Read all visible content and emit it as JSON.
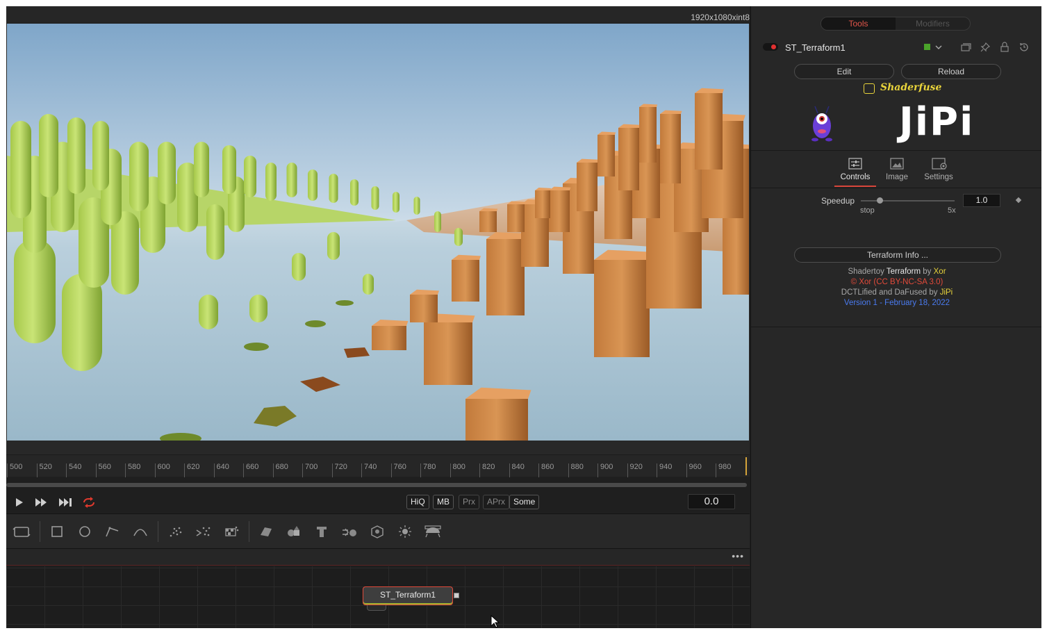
{
  "viewer": {
    "resolution": "1920x1080xint8"
  },
  "timeline": {
    "ticks": [
      "500",
      "520",
      "540",
      "560",
      "580",
      "600",
      "620",
      "640",
      "660",
      "680",
      "700",
      "720",
      "740",
      "760",
      "780",
      "800",
      "820",
      "840",
      "860",
      "880",
      "900",
      "920",
      "940",
      "960",
      "980"
    ]
  },
  "transport": {
    "modes": [
      "HiQ",
      "MB",
      "Prx",
      "APrx",
      "Some"
    ],
    "time": "0.0"
  },
  "toolbar": {
    "tools": [
      "background-icon",
      "rectangle-mask-icon",
      "ellipse-mask-icon",
      "polygon-mask-icon",
      "bspline-mask-icon",
      "particle-emitter-icon",
      "particle-render-icon",
      "particle-checker-icon",
      "image-plane-3d-icon",
      "shape-3d-icon",
      "text-3d-icon",
      "merge-3d-icon",
      "renderer-3d-icon",
      "light-3d-icon",
      "camera-3d-icon"
    ]
  },
  "node_editor": {
    "more_label": "•••",
    "node_label": "ST_Terraform1"
  },
  "inspector": {
    "tabs": {
      "tools": "Tools",
      "modifiers": "Modifiers"
    },
    "node_name": "ST_Terraform1",
    "edit_label": "Edit",
    "reload_label": "Reload",
    "brand": "Shaderfuse",
    "logo": "JiPi",
    "control_tabs": {
      "controls": "Controls",
      "image": "Image",
      "settings": "Settings"
    },
    "speedup": {
      "label": "Speedup",
      "value": "1.0",
      "value_fraction": 0.2,
      "min_label": "stop",
      "max_label": "5x"
    },
    "info_button": "Terraform Info ...",
    "credits": {
      "line1_a": "Shadertoy ",
      "line1_b": "Terraform",
      "line1_c": " by ",
      "line1_d": "Xor",
      "line2": "© Xor (CC BY-NC-SA 3.0)",
      "line3_a": "DCTLified and DaFused by ",
      "line3_b": "JiPi",
      "line4": "Version 1 - February 18, 2022"
    },
    "colors": {
      "accent": "#e2554a",
      "yellow": "#e9d43b",
      "blue": "#4a7bf0",
      "node_color": "#4aa32a"
    }
  }
}
